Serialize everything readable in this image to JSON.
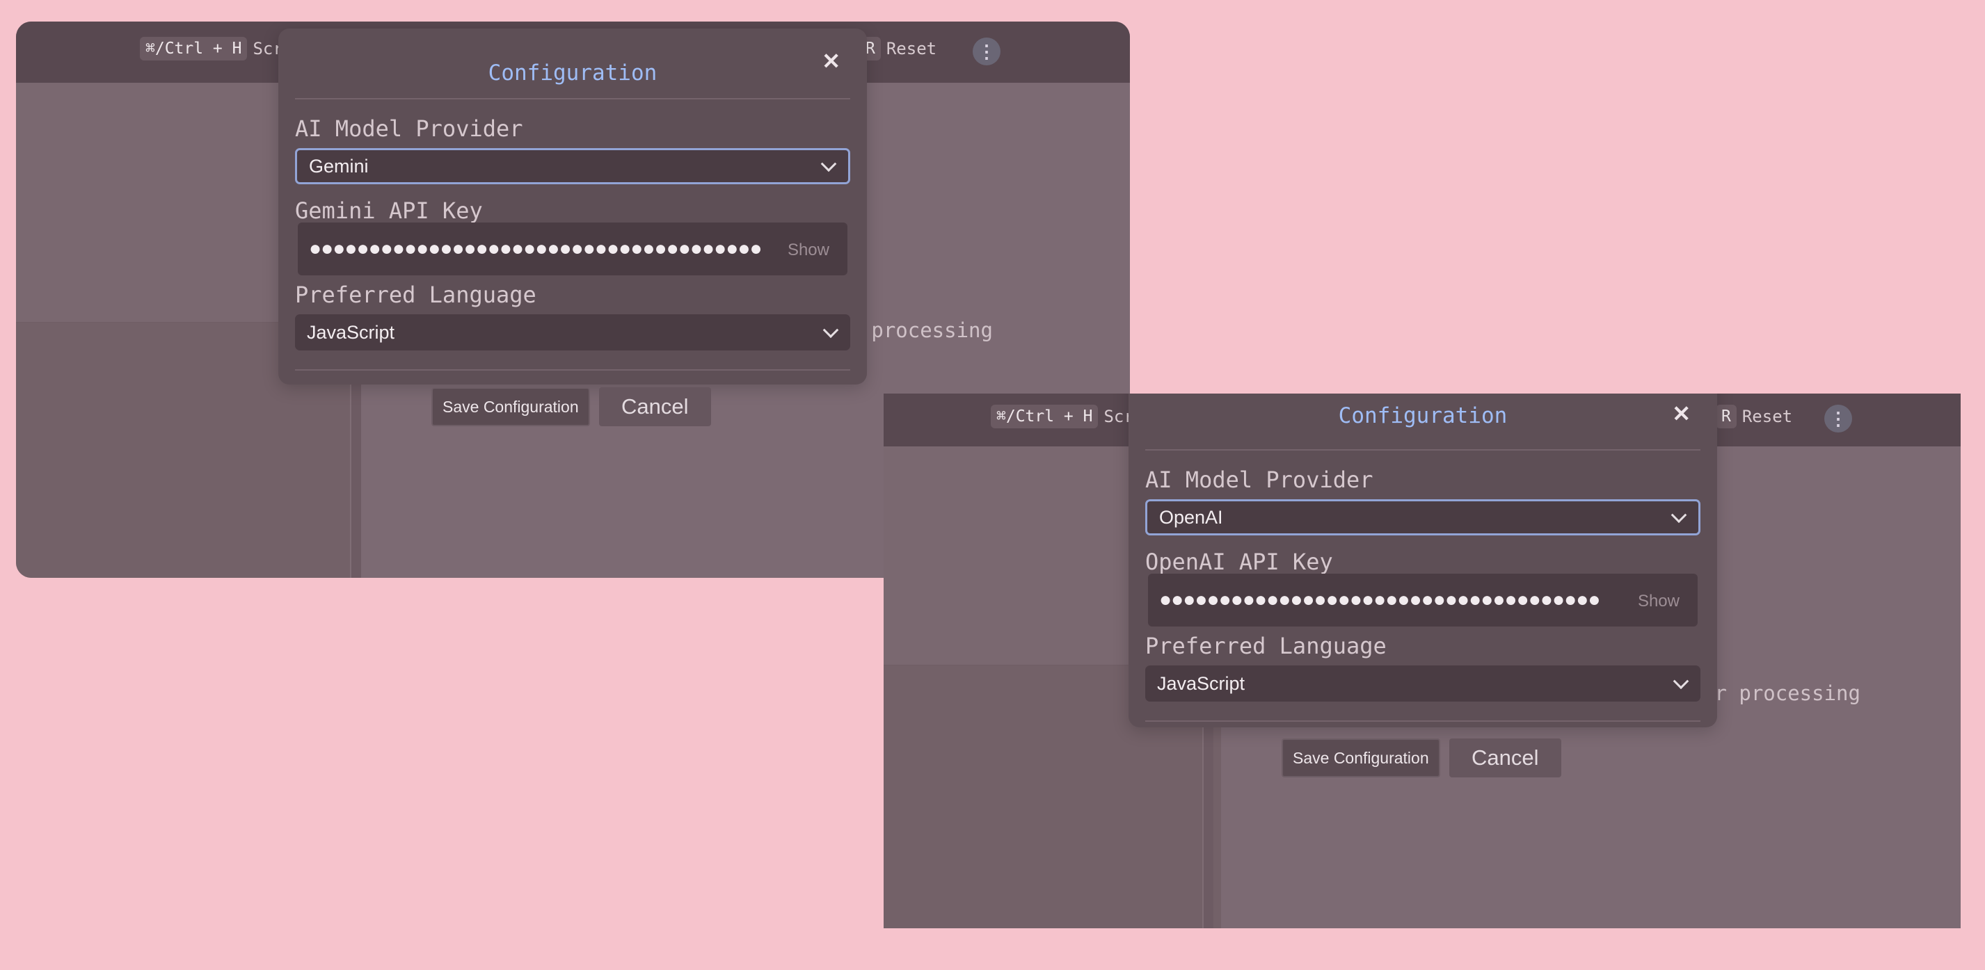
{
  "windows": [
    {
      "toolbar": {
        "kbd1": "⌘/Ctrl + H",
        "screenshot_partial": "Scr",
        "kbd2": "R",
        "reset_label": "Reset",
        "menu_glyph": "⋮"
      },
      "background_text": "er processing",
      "dialog": {
        "title": "Configuration",
        "close_glyph": "✕",
        "provider_label": "AI Model Provider",
        "provider_value": "Gemini",
        "api_key_label": "Gemini API Key",
        "api_key_value": "●●●●●●●●●●●●●●●●●●●●●●●●●●●●●●●●●●●●●●",
        "show_label": "Show",
        "language_label": "Preferred Language",
        "language_value": "JavaScript",
        "save_label": "Save Configuration",
        "cancel_label": "Cancel"
      }
    },
    {
      "toolbar": {
        "kbd1": "⌘/Ctrl + H",
        "screenshot_partial": "Scr",
        "kbd2": "R",
        "reset_label": "Reset",
        "menu_glyph": "⋮"
      },
      "background_text": "er processing",
      "dialog": {
        "title": "Configuration",
        "close_glyph": "✕",
        "provider_label": "AI Model Provider",
        "provider_value": "OpenAI",
        "api_key_label": "OpenAI API Key",
        "api_key_value": "●●●●●●●●●●●●●●●●●●●●●●●●●●●●●●●●●●●●●",
        "show_label": "Show",
        "language_label": "Preferred Language",
        "language_value": "JavaScript",
        "save_label": "Save Configuration",
        "cancel_label": "Cancel"
      }
    }
  ]
}
